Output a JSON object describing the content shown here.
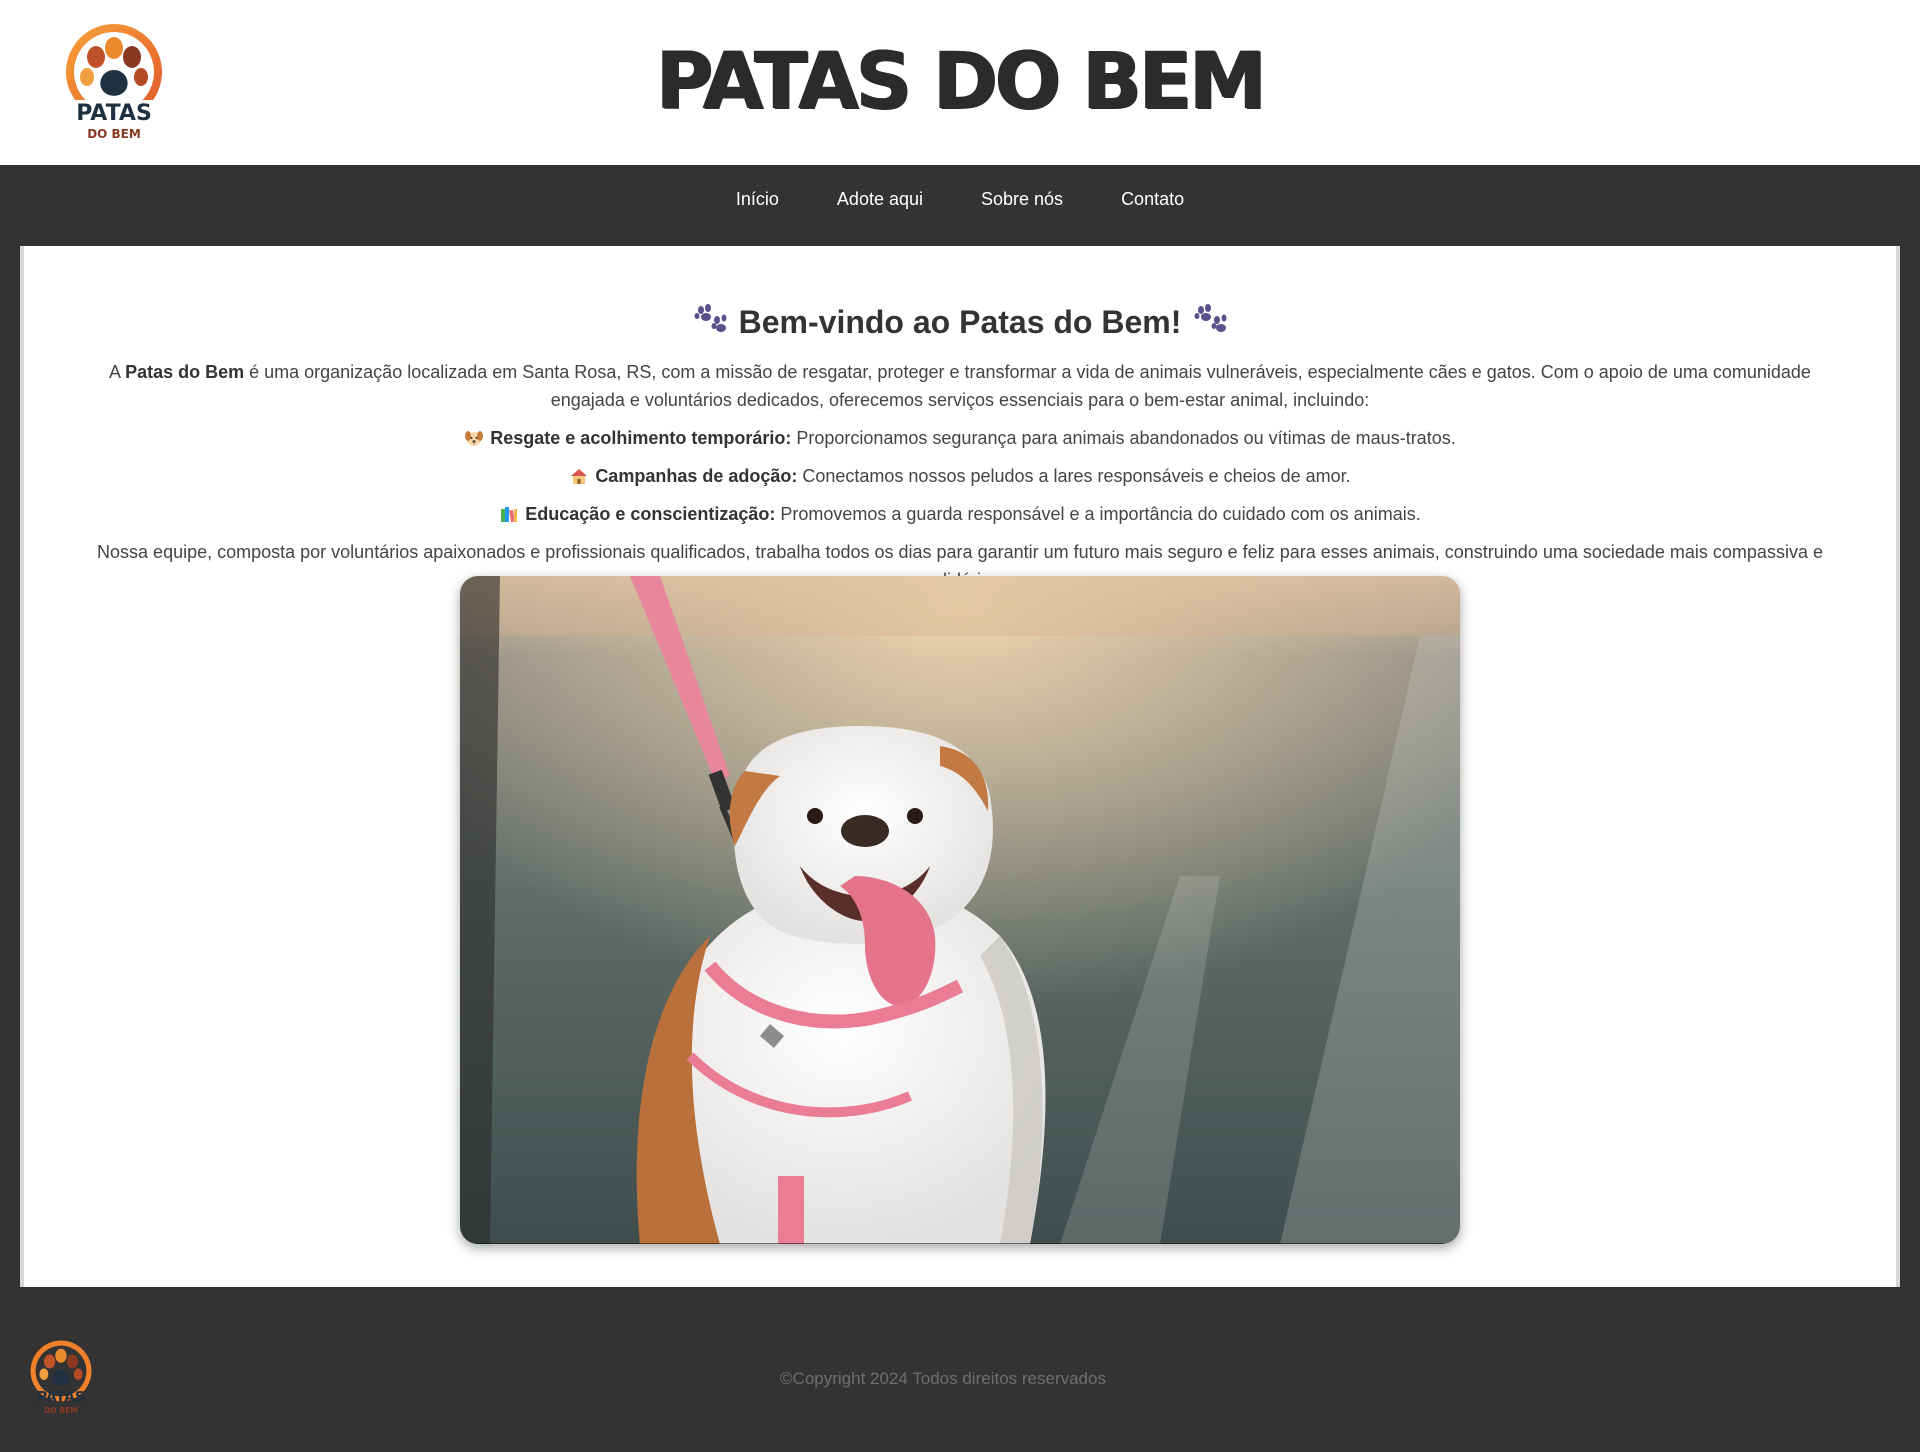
{
  "header": {
    "site_title": "PATAS DO BEM",
    "logo_text_top": "PATAS",
    "logo_text_bottom": "DO BEM"
  },
  "nav": {
    "items": [
      {
        "label": "Início"
      },
      {
        "label": "Adote aqui"
      },
      {
        "label": "Sobre nós"
      },
      {
        "label": "Contato"
      }
    ]
  },
  "main": {
    "heading": "Bem-vindo ao Patas do Bem!",
    "intro_prefix": "A ",
    "intro_bold": "Patas do Bem",
    "intro_rest": " é uma organização localizada em Santa Rosa, RS, com a missão de resgatar, proteger e transformar a vida de animais vulneráveis, especialmente cães e gatos. Com o apoio de uma comunidade engajada e voluntários dedicados, oferecemos serviços essenciais para o bem-estar animal, incluindo:",
    "services": [
      {
        "icon": "dog-face-icon",
        "title": "Resgate e acolhimento temporário:",
        "text": " Proporcionamos segurança para animais abandonados ou vítimas de maus-tratos."
      },
      {
        "icon": "house-icon",
        "title": "Campanhas de adoção:",
        "text": " Conectamos nossos peludos a lares responsáveis e cheios de amor."
      },
      {
        "icon": "books-icon",
        "title": "Educação e conscientização:",
        "text": " Promovemos a guarda responsável e a importância do cuidado com os animais."
      }
    ],
    "team_text": "Nossa equipe, composta por voluntários apaixonados e profissionais qualificados, trabalha todos os dias para garantir um futuro mais seguro e feliz para esses animais, construindo uma sociedade mais compassiva e solidária."
  },
  "footer": {
    "copyright": "©Copyright 2024 Todos direitos reservados"
  },
  "colors": {
    "nav_bg": "#333333",
    "header_bg": "#ffffff",
    "logo_orange": "#f0802a",
    "logo_dark": "#1f3140",
    "paw_purple": "#5b4f8c"
  }
}
